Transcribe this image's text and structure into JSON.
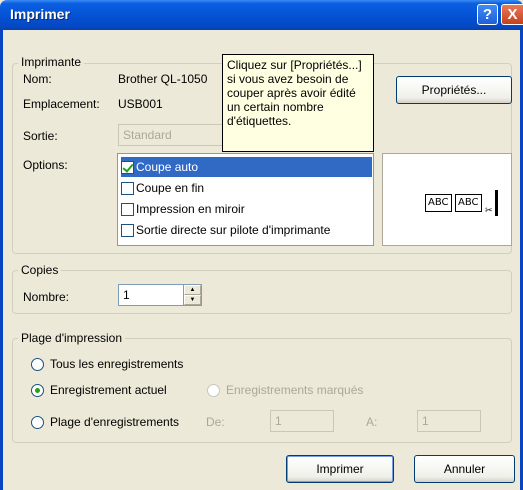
{
  "window": {
    "title": "Imprimer"
  },
  "titlebar": {
    "help": "?",
    "close": "X"
  },
  "printer": {
    "legend": "Imprimante",
    "name_label": "Nom:",
    "name_value": "Brother QL-1050",
    "location_label": "Emplacement:",
    "location_value": "USB001",
    "output_label": "Sortie:",
    "output_value": "Standard",
    "options_label": "Options:",
    "properties_button": "Propriétés...",
    "options": [
      {
        "label": "Coupe auto",
        "checked": true,
        "selected": true
      },
      {
        "label": "Coupe en fin",
        "checked": false
      },
      {
        "label": "Impression en miroir",
        "checked": false
      },
      {
        "label": "Sortie directe sur pilote d'imprimante",
        "checked": false
      }
    ],
    "tooltip": "Cliquez sur [Propriétés...] si vous avez besoin de couper après avoir édité un certain nombre d'étiquettes.",
    "preview_labels": [
      "ABC",
      "ABC"
    ]
  },
  "copies": {
    "legend": "Copies",
    "number_label": "Nombre:",
    "number_value": "1"
  },
  "range": {
    "legend": "Plage d'impression",
    "all_records": "Tous les enregistrements",
    "current_record": "Enregistrement actuel",
    "marked_records": "Enregistrements marqués",
    "record_range": "Plage d'enregistrements",
    "from_label": "De:",
    "from_value": "1",
    "to_label": "A:",
    "to_value": "1",
    "selected": "current_record"
  },
  "footer": {
    "print_button": "Imprimer",
    "cancel_button": "Annuler"
  }
}
